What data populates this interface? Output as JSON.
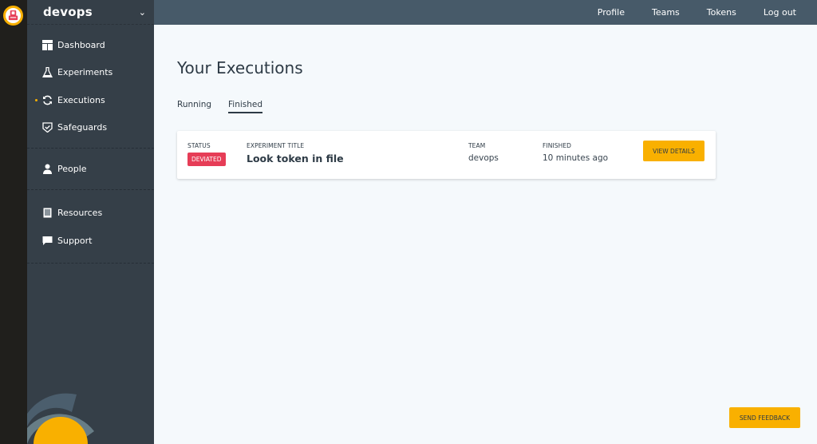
{
  "app": {
    "org_name": "devops",
    "logo": "app-logo-icon"
  },
  "sidebar": {
    "groups": [
      [
        {
          "label": "Dashboard",
          "icon": "dashboard-icon",
          "active": false
        },
        {
          "label": "Experiments",
          "icon": "flask-icon",
          "active": false
        },
        {
          "label": "Executions",
          "icon": "refresh-icon",
          "active": true
        },
        {
          "label": "Safeguards",
          "icon": "shield-check-icon",
          "active": false
        }
      ],
      [
        {
          "label": "People",
          "icon": "person-icon",
          "active": false
        }
      ],
      [
        {
          "label": "Resources",
          "icon": "book-icon",
          "active": false
        },
        {
          "label": "Support",
          "icon": "chat-icon",
          "active": false
        }
      ]
    ]
  },
  "topnav": {
    "links": [
      "Profile",
      "Teams",
      "Tokens",
      "Log out"
    ]
  },
  "main": {
    "title": "Your Executions",
    "tabs": [
      {
        "label": "Running",
        "active": false
      },
      {
        "label": "Finished",
        "active": true
      }
    ],
    "executions": [
      {
        "status_label": "STATUS",
        "status": "DEVIATED",
        "title_label": "EXPERIMENT TITLE",
        "title": "Look token in file",
        "team_label": "TEAM",
        "team": "devops",
        "finished_label": "FINISHED",
        "finished": "10 minutes ago",
        "action_label": "VIEW DETAILS"
      }
    ],
    "feedback_label": "SEND FEEDBACK"
  },
  "colors": {
    "accent": "#f9b000",
    "danger": "#e63d57",
    "sidebar_bg": "#353f48",
    "topbar_bg": "#475a69"
  }
}
